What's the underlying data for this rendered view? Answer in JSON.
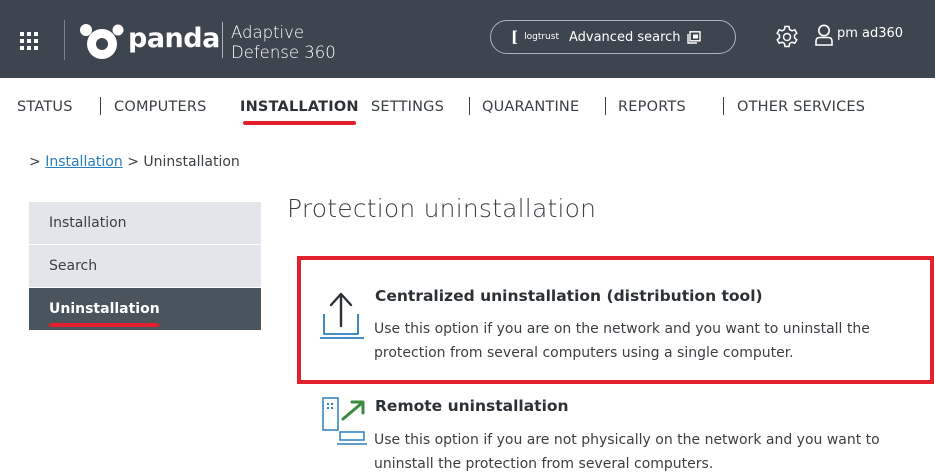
{
  "header": {
    "brand": "panda",
    "product_line1": "Adaptive",
    "product_line2": "Defense 360",
    "search": {
      "logo_mark": "[",
      "logo_name": "logtrust",
      "label": "Advanced search"
    },
    "user_name": "pm ad360",
    "icons": [
      "apps-grid-icon",
      "panda-logo-icon",
      "external-link-icon",
      "gear-icon",
      "user-icon"
    ]
  },
  "nav": {
    "items": [
      {
        "label": "STATUS"
      },
      {
        "label": "COMPUTERS"
      },
      {
        "label": "INSTALLATION",
        "active": true
      },
      {
        "label": "SETTINGS"
      },
      {
        "label": "QUARANTINE"
      },
      {
        "label": "REPORTS"
      },
      {
        "label": "OTHER SERVICES"
      }
    ]
  },
  "breadcrumb": {
    "prefix": ">",
    "link": "Installation",
    "separator": ">",
    "current": "Uninstallation"
  },
  "sidebar": {
    "items": [
      {
        "label": "Installation"
      },
      {
        "label": "Search"
      },
      {
        "label": "Uninstallation",
        "active": true
      }
    ]
  },
  "main": {
    "title": "Protection uninstallation",
    "options": [
      {
        "title": "Centralized uninstallation (distribution tool)",
        "desc_line1": "Use this option if you are on the network and you want to uninstall the",
        "desc_line2": "protection from several computers using a single computer.",
        "icon": "upload-icon",
        "highlighted": true
      },
      {
        "title": "Remote uninstallation",
        "desc_line1": "Use this option if you are not physically on the network and you want to",
        "desc_line2": "uninstall the protection from several computers.",
        "icon": "remote-computer-icon"
      }
    ]
  },
  "colors": {
    "header_bg": "#3d464e",
    "accent_red": "#e3202b",
    "link_blue": "#2a7fc0",
    "icon_blue": "#2a7fc0",
    "arrow_green": "#3a8a3f",
    "sidebar_bg": "#e2e6ea",
    "sidebar_active_bg": "#4a545d"
  }
}
